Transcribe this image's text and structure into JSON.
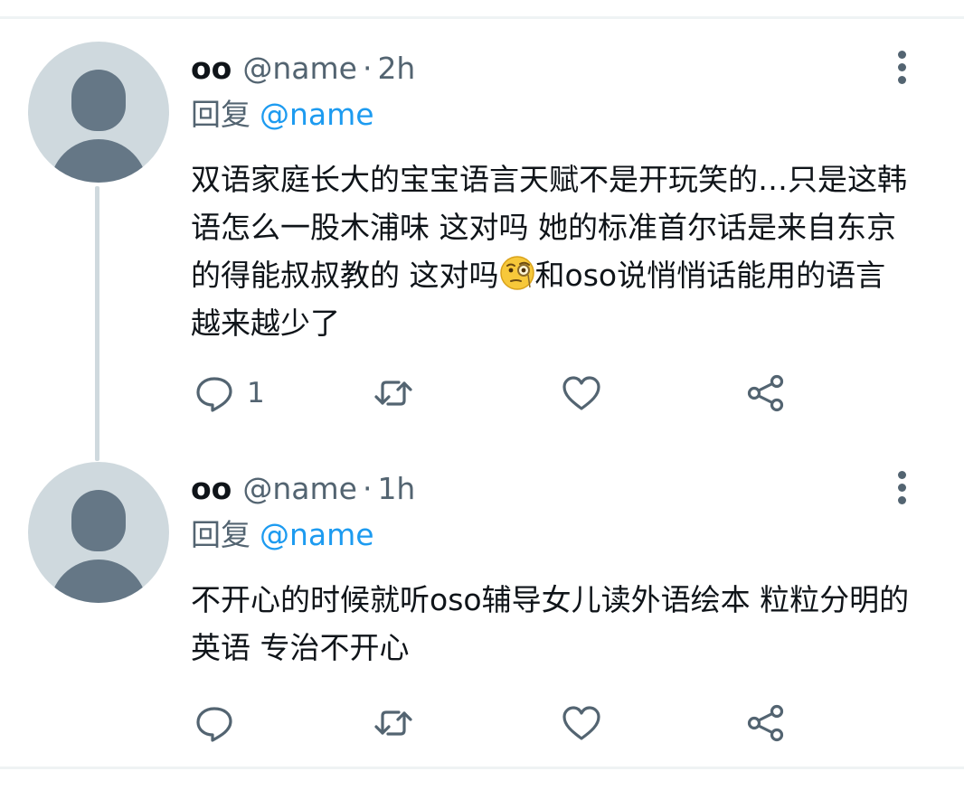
{
  "tweets": [
    {
      "display_name": "oo",
      "handle": "@name",
      "separator": "·",
      "time": "2h",
      "reply_label": "回复",
      "reply_mention": "@name",
      "text_before_emoji": "双语家庭长大的宝宝语言天赋不是开玩笑的…只是这韩语怎么一股木浦味 这对吗 她的标准首尔话是来自东京的得能叔叔教的 这对吗",
      "emoji": "face-with-monocle",
      "text_after_emoji": "和oso说悄悄话能用的语言越来越少了",
      "reply_count": "1"
    },
    {
      "display_name": "oo",
      "handle": "@name",
      "separator": "·",
      "time": "1h",
      "reply_label": "回复",
      "reply_mention": "@name",
      "text": "不开心的时候就听oso辅导女儿读外语绘本 粒粒分明的英语 专治不开心"
    }
  ],
  "icons": {
    "reply": "reply-bubble-icon",
    "retweet": "retweet-icon",
    "like": "heart-icon",
    "share": "share-icon",
    "more": "more-vertical-icon"
  },
  "colors": {
    "text": "#0f1419",
    "secondary": "#536471",
    "link": "#1d9bf0",
    "avatar_bg": "#cfd9de",
    "avatar_fg": "#657786",
    "thread_line": "#cfd9de"
  }
}
